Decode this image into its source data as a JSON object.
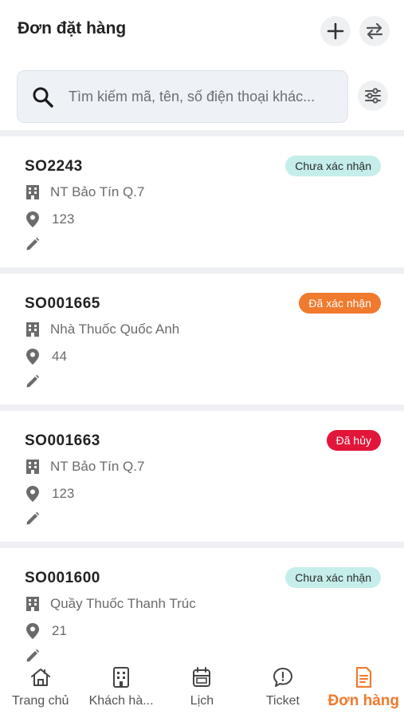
{
  "header": {
    "title": "Đơn đặt hàng"
  },
  "search": {
    "placeholder": "Tìm kiếm mã, tên, số điện thoại khác..."
  },
  "colors": {
    "accent": "#f07a2e",
    "pending_bg": "#c5eeea",
    "cancelled_bg": "#e2163a"
  },
  "orders": [
    {
      "code": "SO2243",
      "status": "Chưa xác nhận",
      "status_type": "pending",
      "store": "NT Bảo Tín Q.7",
      "location": "123"
    },
    {
      "code": "SO001665",
      "status": "Đã xác nhận",
      "status_type": "confirmed",
      "store": "Nhà Thuốc Quốc Anh",
      "location": "44"
    },
    {
      "code": "SO001663",
      "status": "Đã hủy",
      "status_type": "cancelled",
      "store": "NT Bảo Tín Q.7",
      "location": "123"
    },
    {
      "code": "SO001600",
      "status": "Chưa xác nhận",
      "status_type": "pending",
      "store": "Quầy Thuốc Thanh Trúc",
      "location": "21"
    }
  ],
  "nav": [
    {
      "label": "Trang chủ",
      "icon": "home-icon"
    },
    {
      "label": "Khách hà...",
      "icon": "building-icon"
    },
    {
      "label": "Lịch",
      "icon": "calendar-icon"
    },
    {
      "label": "Ticket",
      "icon": "ticket-chat-icon"
    },
    {
      "label": "Đơn hàng",
      "icon": "order-document-icon",
      "active": true
    }
  ]
}
